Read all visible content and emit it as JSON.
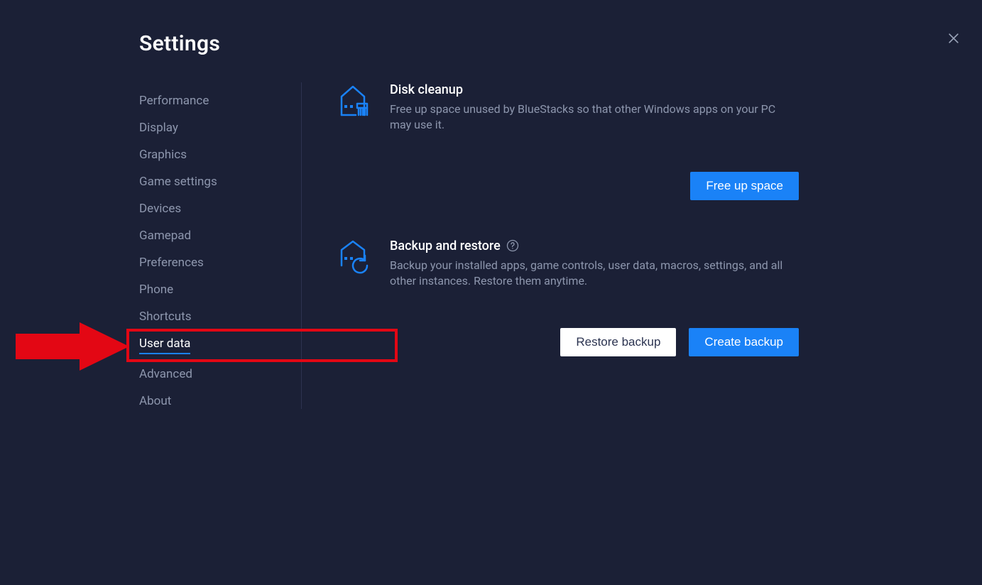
{
  "page_title": "Settings",
  "sidebar": {
    "items": [
      {
        "label": "Performance",
        "active": false
      },
      {
        "label": "Display",
        "active": false
      },
      {
        "label": "Graphics",
        "active": false
      },
      {
        "label": "Game settings",
        "active": false
      },
      {
        "label": "Devices",
        "active": false
      },
      {
        "label": "Gamepad",
        "active": false
      },
      {
        "label": "Preferences",
        "active": false
      },
      {
        "label": "Phone",
        "active": false
      },
      {
        "label": "Shortcuts",
        "active": false
      },
      {
        "label": "User data",
        "active": true
      },
      {
        "label": "Advanced",
        "active": false
      },
      {
        "label": "About",
        "active": false
      }
    ]
  },
  "sections": {
    "disk_cleanup": {
      "title": "Disk cleanup",
      "desc": "Free up space unused by BlueStacks so that other Windows apps on your PC may use it.",
      "action_primary": "Free up space"
    },
    "backup_restore": {
      "title": "Backup and restore",
      "desc": "Backup your installed apps, game controls, user data, macros, settings, and all other instances. Restore them anytime.",
      "action_secondary": "Restore backup",
      "action_primary": "Create backup"
    }
  },
  "annotation": {
    "arrow_target": "User data"
  }
}
